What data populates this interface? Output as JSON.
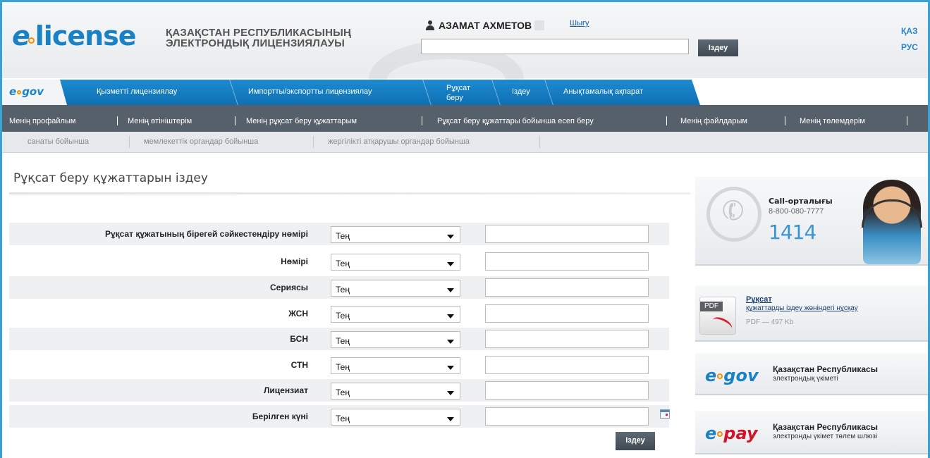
{
  "header": {
    "logo_e": "e",
    "logo_rest": "license",
    "subtitle_line1": "ҚАЗАҚСТАН РЕСПУБЛИКАСЫНЫҢ",
    "subtitle_line2": "ЭЛЕКТРОНДЫҚ ЛИЦЕНЗИЯЛАУЫ",
    "user_name": "АЗАМАТ АХМЕТОВ",
    "logout": "Шығу",
    "search_value": "",
    "search_button": "Іздеу",
    "lang_kaz": "ҚАЗ",
    "lang_rus": "РУС"
  },
  "main_nav": {
    "egov": "gov",
    "egov_prefix": "e",
    "items": [
      "Қызметті лицензиялау",
      "Импортты/экспортты лицензиялау",
      "Рұқсат беру",
      "Іздеу",
      "Анықтамалық ақпарат"
    ]
  },
  "sub_nav": {
    "items": [
      "Менің профайлым",
      "Менің өтініштерім",
      "Менің рұқсат беру құжаттарым",
      "Рұқсат беру құжаттары бойынша есеп беру",
      "Менің файлдарым",
      "Менің төлемдерім"
    ]
  },
  "filter_nav": {
    "items": [
      "санаты бойынша",
      "мемлекеттік органдар бойынша",
      "жергілікті атқарушы органдар бойынша"
    ]
  },
  "page": {
    "title": "Рұқсат беру құжаттарын іздеу"
  },
  "form": {
    "rows": [
      {
        "label": "Рұқсат құжатының бірегей сәйкестендіру нөмірі",
        "operator": "Тең",
        "value": ""
      },
      {
        "label": "Нөмірі",
        "operator": "Тең",
        "value": ""
      },
      {
        "label": "Сериясы",
        "operator": "Тең",
        "value": ""
      },
      {
        "label": "ЖСН",
        "operator": "Тең",
        "value": ""
      },
      {
        "label": "БСН",
        "operator": "Тең",
        "value": ""
      },
      {
        "label": "СТН",
        "operator": "Тең",
        "value": ""
      },
      {
        "label": "Лицензиат",
        "operator": "Тең",
        "value": ""
      },
      {
        "label": "Берілген күні",
        "operator": "Тең",
        "value": ""
      }
    ],
    "submit": "Іздеу"
  },
  "sidebar": {
    "call_title": "Call-орталығы",
    "call_phone": "8-800-080-7777",
    "call_short": "1414",
    "pdf_badge": "PDF",
    "pdf_title": "Рұқсат",
    "pdf_link": "құжаттарды іздеу жөніндегі нұсқау",
    "pdf_meta": "PDF — 497 Kb",
    "egov_brand_prefix": "e",
    "egov_brand": "gov",
    "egov_title": "Қазақстан Республикасы",
    "egov_sub": "электрондық үкіметі",
    "epay_brand_prefix": "e",
    "epay_brand": "pay",
    "epay_title": "Қазақстан Республикасы",
    "epay_sub": "электронды үкімет төлем шлюзі"
  },
  "colors": {
    "accent_blue": "#1a82c4",
    "nav_blue": "#1d8bd1",
    "subnav_dark": "#56606a",
    "logo_dot_orange": "#f39200"
  }
}
